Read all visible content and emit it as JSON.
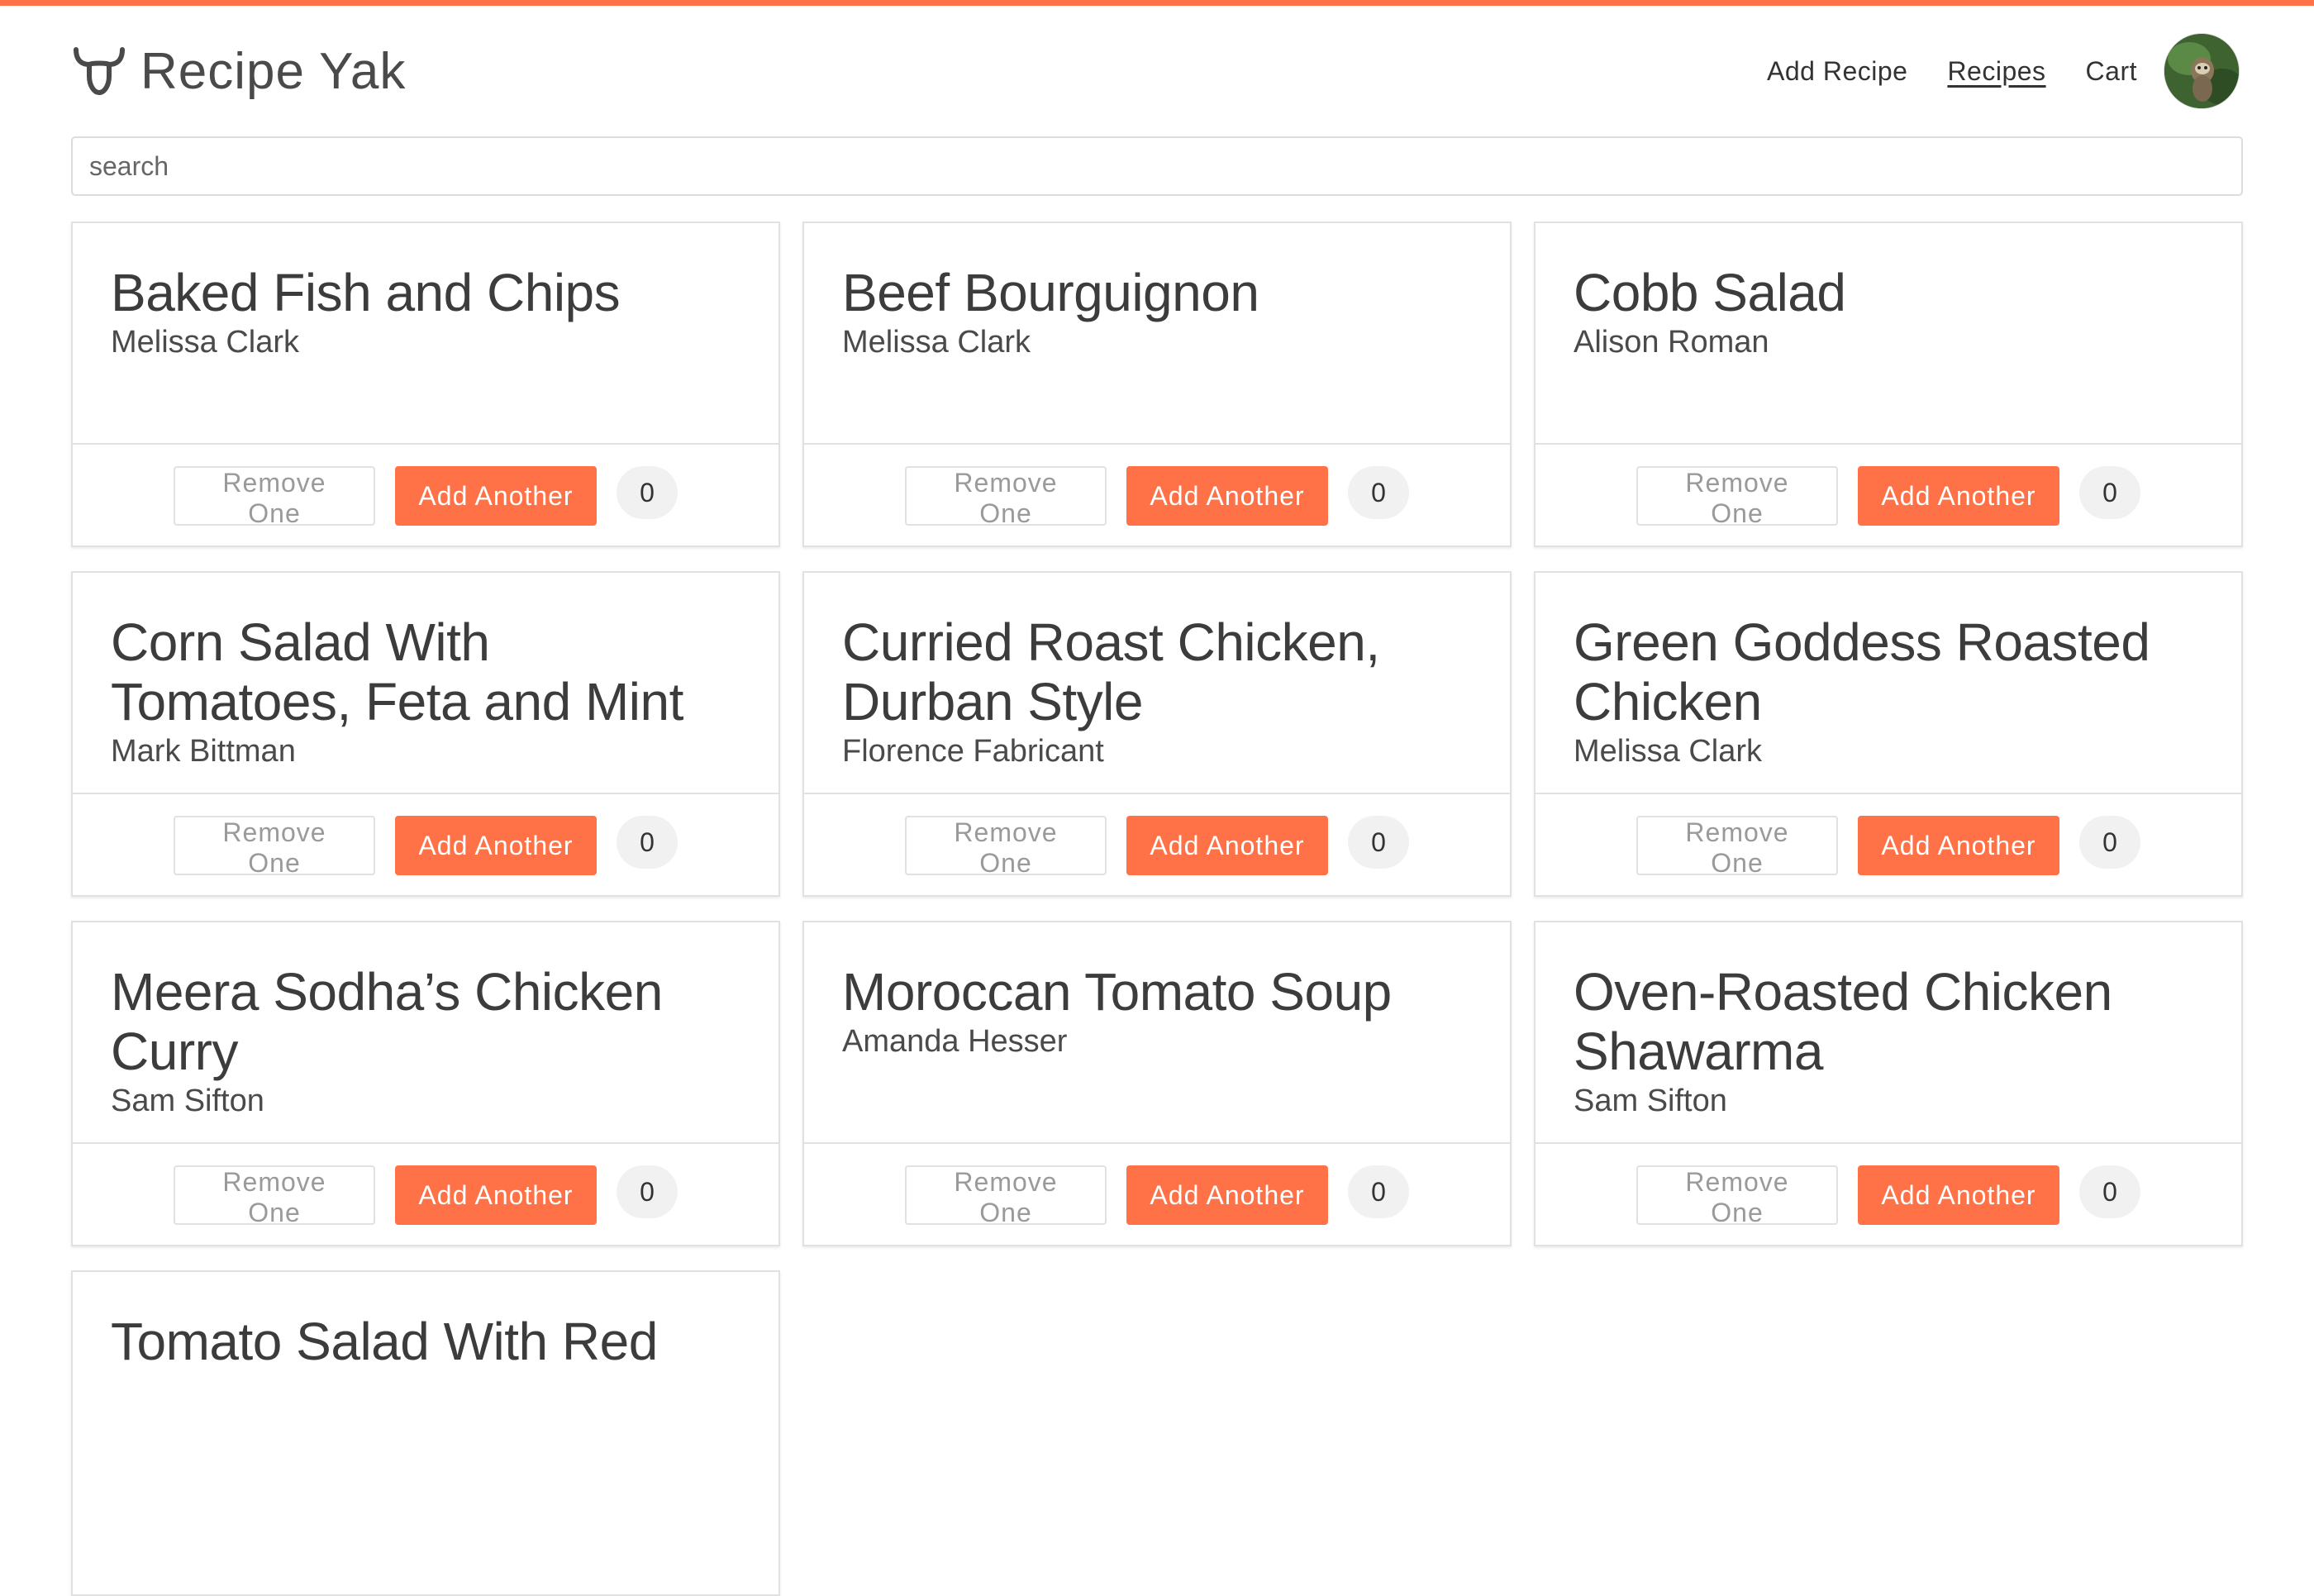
{
  "app": {
    "brand": "Recipe Yak",
    "accent_color": "#ff7247",
    "brand_icon": "bull-horns-icon"
  },
  "nav": {
    "add_recipe": "Add Recipe",
    "recipes": "Recipes",
    "cart": "Cart",
    "active": "recipes",
    "avatar_icon": "user-avatar"
  },
  "search": {
    "placeholder": "search",
    "value": ""
  },
  "card_labels": {
    "remove": "Remove One",
    "add": "Add Another"
  },
  "recipes": [
    {
      "title": "Baked Fish and Chips",
      "author": "Melissa Clark",
      "count": "0"
    },
    {
      "title": "Beef Bourguignon",
      "author": "Melissa Clark",
      "count": "0"
    },
    {
      "title": "Cobb Salad",
      "author": "Alison Roman",
      "count": "0"
    },
    {
      "title": "Corn Salad With Tomatoes, Feta and Mint",
      "author": "Mark Bittman",
      "count": "0"
    },
    {
      "title": "Curried Roast Chicken, Durban Style",
      "author": "Florence Fabricant",
      "count": "0"
    },
    {
      "title": "Green Goddess Roasted Chicken",
      "author": "Melissa Clark",
      "count": "0"
    },
    {
      "title": "Meera Sodha’s Chicken Curry",
      "author": "Sam Sifton",
      "count": "0"
    },
    {
      "title": "Moroccan Tomato Soup",
      "author": "Amanda Hesser",
      "count": "0"
    },
    {
      "title": "Oven-Roasted Chicken Shawarma",
      "author": "Sam Sifton",
      "count": "0"
    },
    {
      "title": "Tomato Salad With Red"
    }
  ]
}
